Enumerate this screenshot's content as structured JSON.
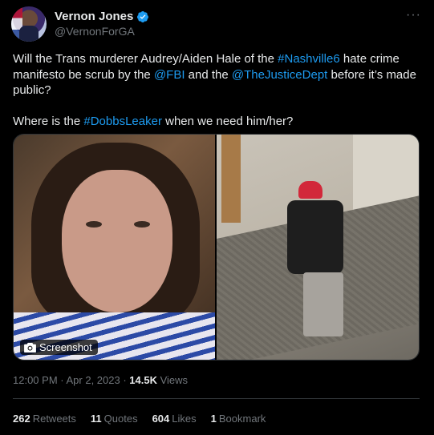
{
  "author": {
    "name": "Vernon Jones",
    "handle": "@VernonForGA"
  },
  "tweet": {
    "segments_line1": [
      "Will the Trans murderer Audrey/Aiden Hale of the ",
      "#Nashville6",
      " hate crime manifesto be scrub by the ",
      "@FBI",
      " and the ",
      "@TheJusticeDept",
      " before it’s made public?"
    ],
    "segments_line2": [
      "Where is the ",
      "#DobbsLeaker",
      " when we need him/her?"
    ]
  },
  "media": {
    "badge_label": "Screenshot"
  },
  "meta": {
    "time": "12:00 PM",
    "sep": " · ",
    "date": "Apr 2, 2023",
    "views_count": "14.5K",
    "views_label": "Views"
  },
  "stats": {
    "retweets_count": "262",
    "retweets_label": "Retweets",
    "quotes_count": "11",
    "quotes_label": "Quotes",
    "likes_count": "604",
    "likes_label": "Likes",
    "bookmarks_count": "1",
    "bookmarks_label": "Bookmark"
  },
  "colors": {
    "background": "#000000",
    "text": "#e7e9ea",
    "secondary": "#71767b",
    "link": "#1d9bf0",
    "border": "#2f3336"
  },
  "icons": [
    "verified-badge-icon",
    "more-options-icon",
    "camera-icon"
  ]
}
